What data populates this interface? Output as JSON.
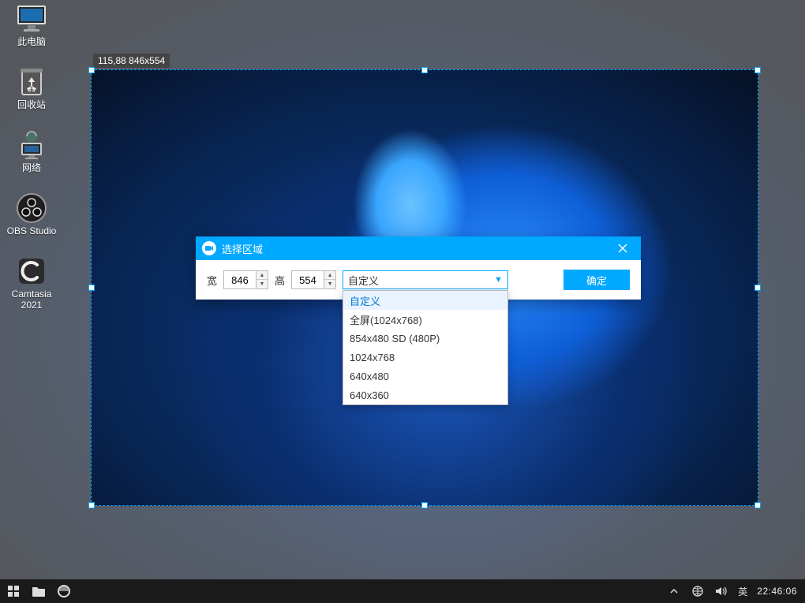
{
  "desktop_icons": [
    {
      "id": "this-pc",
      "label": "此电脑"
    },
    {
      "id": "recycle-bin",
      "label": "回收站"
    },
    {
      "id": "network",
      "label": "网络"
    },
    {
      "id": "obs",
      "label": "OBS Studio"
    },
    {
      "id": "camtasia",
      "label": "Camtasia\n2021"
    }
  ],
  "selection": {
    "coords_label": "115,88 846x554"
  },
  "dialog": {
    "title": "选择区域",
    "width_label": "宽",
    "width_value": "846",
    "height_label": "高",
    "height_value": "554",
    "preset_selected": "自定义",
    "preset_options": [
      "自定义",
      "全屏(1024x768)",
      "854x480 SD (480P)",
      "1024x768",
      "640x480",
      "640x360"
    ],
    "ok_label": "确定"
  },
  "taskbar": {
    "ime": "英",
    "clock": "22:46:06"
  }
}
